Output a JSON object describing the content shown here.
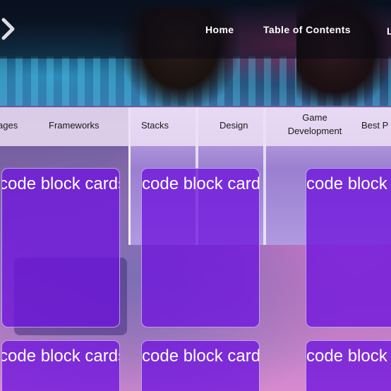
{
  "topbar": {
    "menu_icon": "chevron-right-icon",
    "links": [
      {
        "label": "Home"
      },
      {
        "label": "Table of Contents"
      }
    ]
  },
  "categories": [
    {
      "label": "ages"
    },
    {
      "label": "Frameworks"
    },
    {
      "label": "Stacks"
    },
    {
      "label": "Design"
    },
    {
      "label": "Game Development",
      "line1": "Game",
      "line2": "Development"
    },
    {
      "label": "Best P"
    }
  ],
  "cards": [
    {
      "title": "code block cards"
    },
    {
      "title": "code block cards"
    },
    {
      "title": "code block cards"
    },
    {
      "title": "code block cards"
    },
    {
      "title": "code block cards"
    },
    {
      "title": "code block cards"
    }
  ],
  "colors": {
    "card_fill": "#6e14dc",
    "category_bar": "#ecdef4",
    "nav_text": "#ffffff"
  }
}
